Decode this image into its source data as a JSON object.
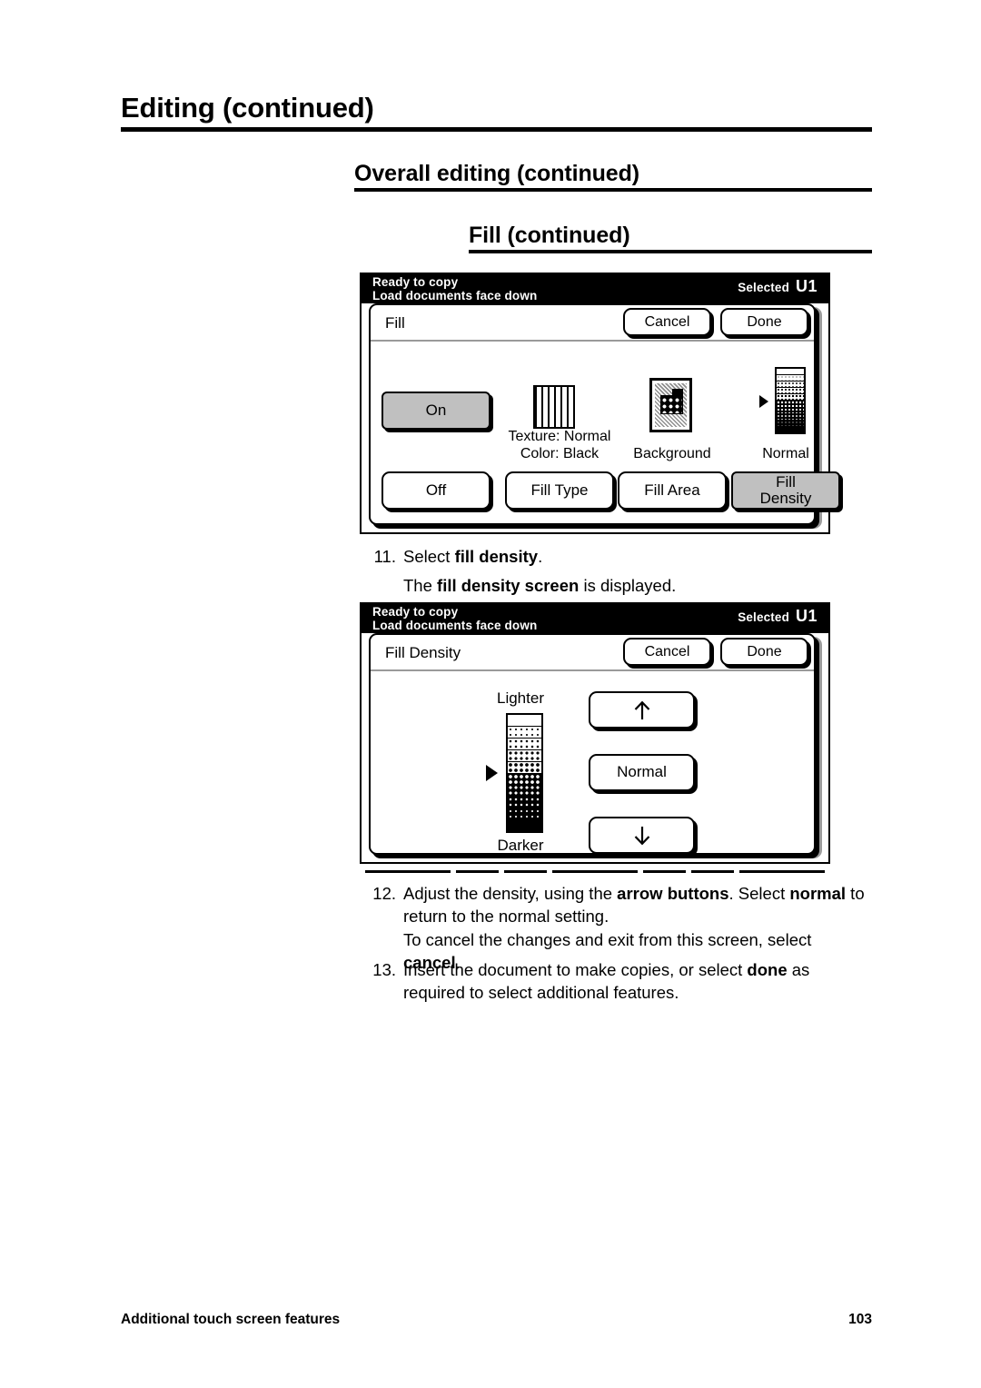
{
  "headings": {
    "h1": "Editing (continued)",
    "h2": "Overall editing (continued)",
    "h3": "Fill (continued)"
  },
  "panel_fill": {
    "status": {
      "line1": "Ready to copy",
      "line2": "Load documents face down",
      "selected_label": "Selected",
      "selected_value": "U1"
    },
    "card_title": "Fill",
    "cancel_label": "Cancel",
    "done_label": "Done",
    "on_label": "On",
    "off_label": "Off",
    "texture_caption_line1": "Texture: Normal",
    "texture_caption_line2": "Color: Black",
    "background_caption": "Background",
    "density_caption": "Normal",
    "fill_type_label": "Fill Type",
    "fill_area_label": "Fill Area",
    "fill_density_label_line1": "Fill",
    "fill_density_label_line2": "Density"
  },
  "panel_density": {
    "status": {
      "line1": "Ready to copy",
      "line2": "Load documents face down",
      "selected_label": "Selected",
      "selected_value": "U1"
    },
    "card_title": "Fill Density",
    "cancel_label": "Cancel",
    "done_label": "Done",
    "lighter_label": "Lighter",
    "darker_label": "Darker",
    "normal_label": "Normal",
    "up_arrow_icon": "arrow-up-icon",
    "down_arrow_icon": "arrow-down-icon",
    "pointer_icon": "density-pointer-icon",
    "scale_steps": 10,
    "pointer_step": 5
  },
  "steps": [
    {
      "number": "11.",
      "segments": [
        {
          "t": "Select ",
          "b": false
        },
        {
          "t": "fill density",
          "b": true
        },
        {
          "t": ".",
          "b": false
        }
      ]
    },
    {
      "number": "",
      "segments": [
        {
          "t": "The ",
          "b": false
        },
        {
          "t": "fill density screen",
          "b": true
        },
        {
          "t": " is displayed.",
          "b": false
        }
      ]
    },
    {
      "number": "12.",
      "segments": [
        {
          "t": "Adjust the density, using the ",
          "b": false
        },
        {
          "t": "arrow buttons",
          "b": true
        },
        {
          "t": ".  Select ",
          "b": false
        },
        {
          "t": "normal",
          "b": true
        },
        {
          "t": " to return to the normal setting.",
          "b": false
        }
      ]
    },
    {
      "number": "",
      "segments": [
        {
          "t": "To cancel the changes and exit from this screen, select ",
          "b": false
        },
        {
          "t": "cancel",
          "b": true
        },
        {
          "t": ".",
          "b": false
        }
      ]
    },
    {
      "number": "13.",
      "segments": [
        {
          "t": "Insert the document to make copies, or select ",
          "b": false
        },
        {
          "t": "done",
          "b": true
        },
        {
          "t": " as required to select additional features.",
          "b": false
        }
      ]
    }
  ],
  "footer": {
    "left": "Additional touch screen features",
    "page_number": "103"
  },
  "colors": {
    "selected_button": "#c0c0c0",
    "header_bar": "#000000",
    "page_background": "#ffffff"
  }
}
